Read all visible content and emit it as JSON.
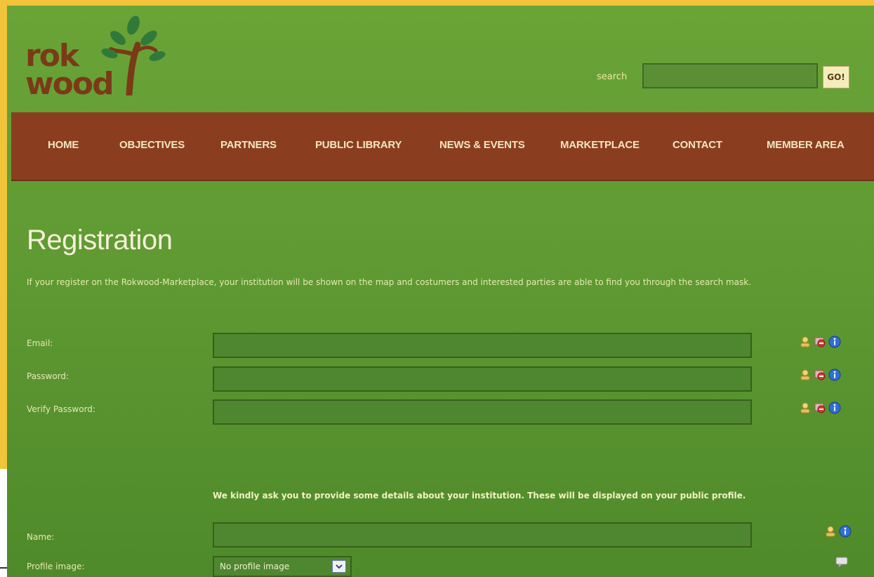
{
  "logo": {
    "line1": "rok",
    "line2": "wood"
  },
  "search": {
    "label": "search",
    "value": "",
    "button": "GO!"
  },
  "nav": {
    "items": [
      {
        "label": "HOME"
      },
      {
        "label": "OBJECTIVES"
      },
      {
        "label": "PARTNERS"
      },
      {
        "label": "PUBLIC LIBRARY"
      },
      {
        "label": "NEWS & EVENTS"
      },
      {
        "label": "MARKETPLACE"
      },
      {
        "label": "CONTACT"
      },
      {
        "label": "MEMBER AREA"
      }
    ]
  },
  "page": {
    "title": "Registration",
    "intro": "If your register on the Rokwood-Marketplace, your institution will be shown on the map and costumers and interested parties are able to find you through the search mask."
  },
  "form": {
    "email": {
      "label": "Email:",
      "value": ""
    },
    "password": {
      "label": "Password:",
      "value": ""
    },
    "verify_password": {
      "label": "Verify Password:",
      "value": ""
    },
    "details_note": "We kindly ask you to provide some details about your institution. These will be displayed on your public profile.",
    "name": {
      "label": "Name:",
      "value": ""
    },
    "profile_image": {
      "label": "Profile image:",
      "selected": "No profile image"
    }
  },
  "icons": {
    "user": "user-icon",
    "required": "required-icon",
    "info": "info-icon",
    "comment": "comment-icon"
  },
  "colors": {
    "background_green": "#5f9a33",
    "nav_brown": "#8b3e1f",
    "frame_yellow": "#f2c43a",
    "logo_brown": "#7a3a18"
  }
}
